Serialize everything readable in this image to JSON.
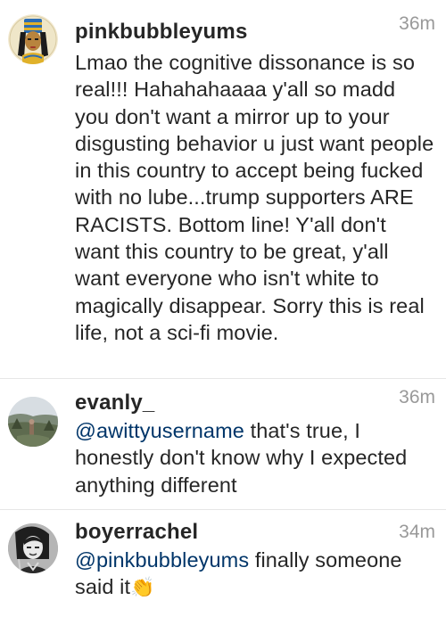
{
  "comments": [
    {
      "username": "pinkbubbleyums",
      "time": "36m",
      "text": "Lmao the cognitive dissonance is so real!!! Hahahahaaaa y'all so madd you don't want a mirror up to your disgusting behavior u just want people in this country to accept being fucked with no lube...trump supporters ARE RACISTS. Bottom line! Y'all don't want this country to be great, y'all want everyone who isn't white to magically disappear. Sorry this is real life, not a sci-fi movie.",
      "avatar": "egyptian-queen-avatar"
    },
    {
      "username": "evanly_",
      "time": "36m",
      "mention": "@awittyusername",
      "text": " that's true, I honestly don't know why I expected anything different",
      "avatar": "landscape-photo-avatar"
    },
    {
      "username": "boyerrachel",
      "time": "34m",
      "mention": "@pinkbubbleyums",
      "text": " finally someone said it",
      "emoji": "👏",
      "avatar": "bw-portrait-avatar"
    }
  ],
  "colors": {
    "text": "#262626",
    "timestamp": "#999999",
    "mention": "#003569",
    "divider": "#e6e6e6"
  }
}
